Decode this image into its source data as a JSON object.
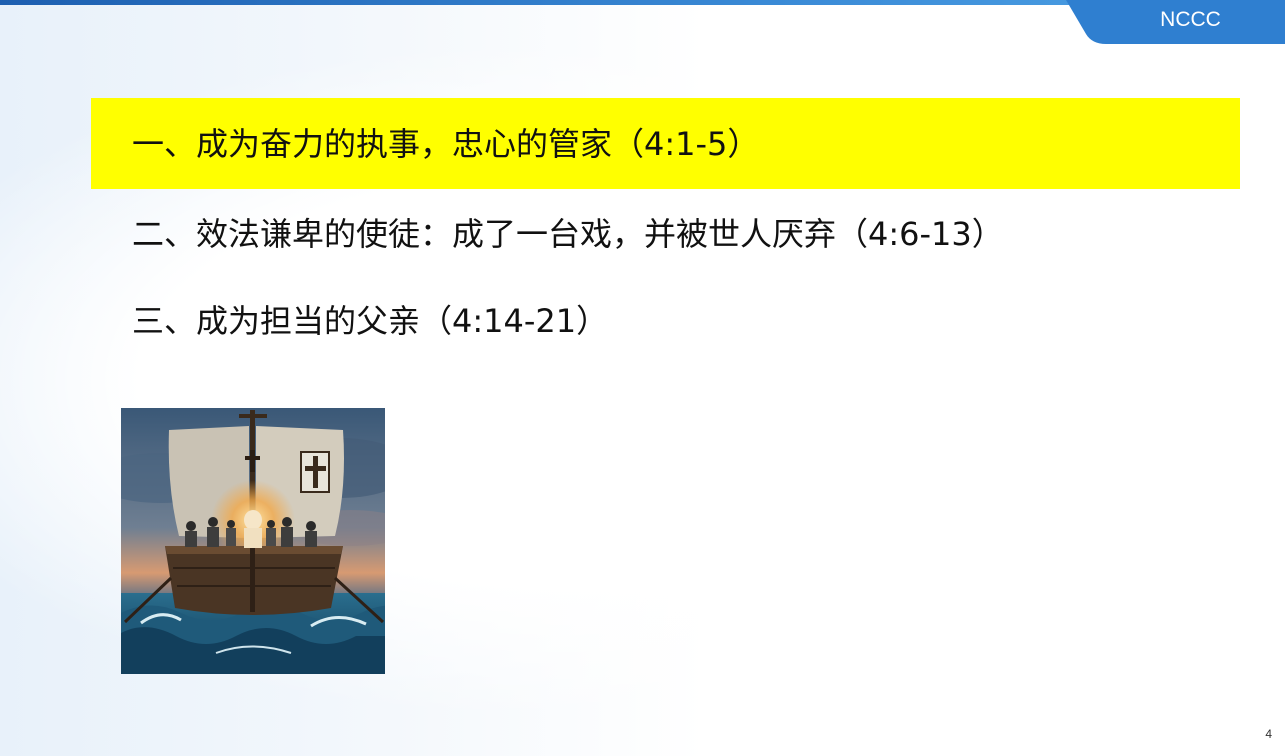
{
  "header": {
    "brand": "NCCC"
  },
  "outline": {
    "items": [
      {
        "label": "一、成为奋力的执事，忠心的管家（4:1-5）",
        "highlighted": true
      },
      {
        "label": "二、效法谦卑的使徒：成了一台戏，并被世人厌弃（4:6-13）",
        "highlighted": false
      },
      {
        "label": "三、成为担当的父亲（4:14-21）",
        "highlighted": false
      }
    ]
  },
  "illustration": {
    "icon": "ship-with-cross-sail-image"
  },
  "footer": {
    "slide_number": "4"
  },
  "colors": {
    "accent_blue": "#2f7fd0",
    "highlight": "#ffff00",
    "text": "#111111"
  }
}
